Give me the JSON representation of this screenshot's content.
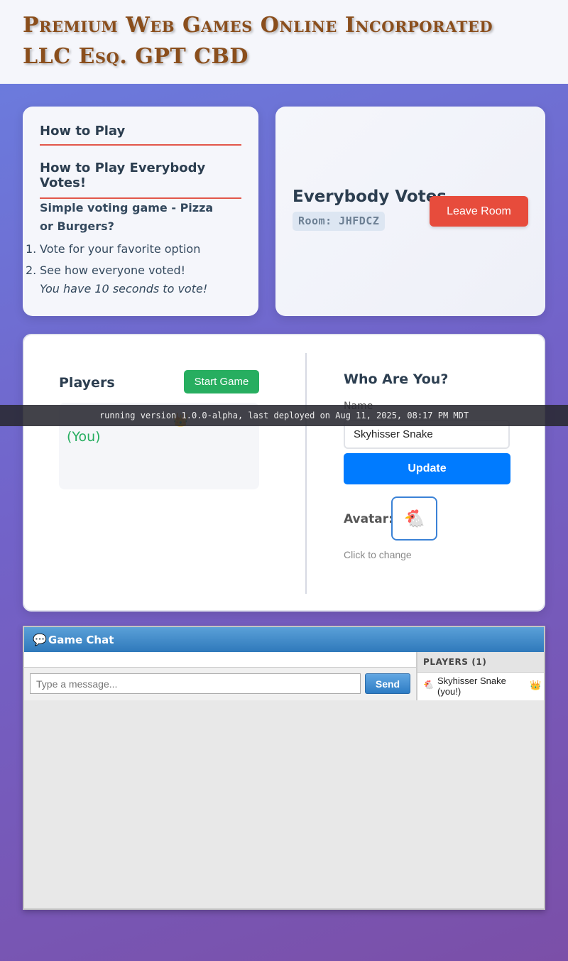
{
  "header": {
    "title": "Premium Web Games Online Incorporated LLC Esq. GPT CBD"
  },
  "how_to": {
    "heading": "How to Play",
    "subheading": "How to Play Everybody Votes!",
    "description": "Simple voting game - Pizza or Burgers?",
    "steps": [
      {
        "num": "1.",
        "text": "Vote for your favorite option"
      },
      {
        "num": "2.",
        "text": "See how everyone voted!"
      }
    ],
    "note": "You have 10 seconds to vote!"
  },
  "room": {
    "game_title": "Everybody Votes",
    "room_code": "Room: JHFDCZ",
    "leave_label": "Leave Room"
  },
  "players_panel": {
    "title": "Players",
    "start_label": "Start Game",
    "you_label": "(You)",
    "crown_icon": "👑"
  },
  "profile": {
    "title": "Who Are You?",
    "name_label": "Name",
    "name_value": "Skyhisser Snake",
    "update_label": "Update",
    "avatar_label": "Avatar:",
    "avatar_emoji": "🐔",
    "avatar_hint": "Click to change"
  },
  "version_bar": {
    "text": "running version 1.0.0-alpha, last deployed on Aug 11, 2025, 08:17 PM MDT"
  },
  "chat": {
    "title": "Game Chat",
    "icon": "💬",
    "input_placeholder": "Type a message...",
    "send_label": "Send",
    "players_header": "PLAYERS (1)",
    "players": [
      {
        "avatar": "🐔",
        "name": "Skyhisser Snake (you!)",
        "crown": "👑"
      }
    ]
  },
  "colors": {
    "accent_red": "#e74c3c",
    "start_green": "#27ae60",
    "update_blue": "#007bff",
    "title_brown": "#8a4e1c"
  }
}
